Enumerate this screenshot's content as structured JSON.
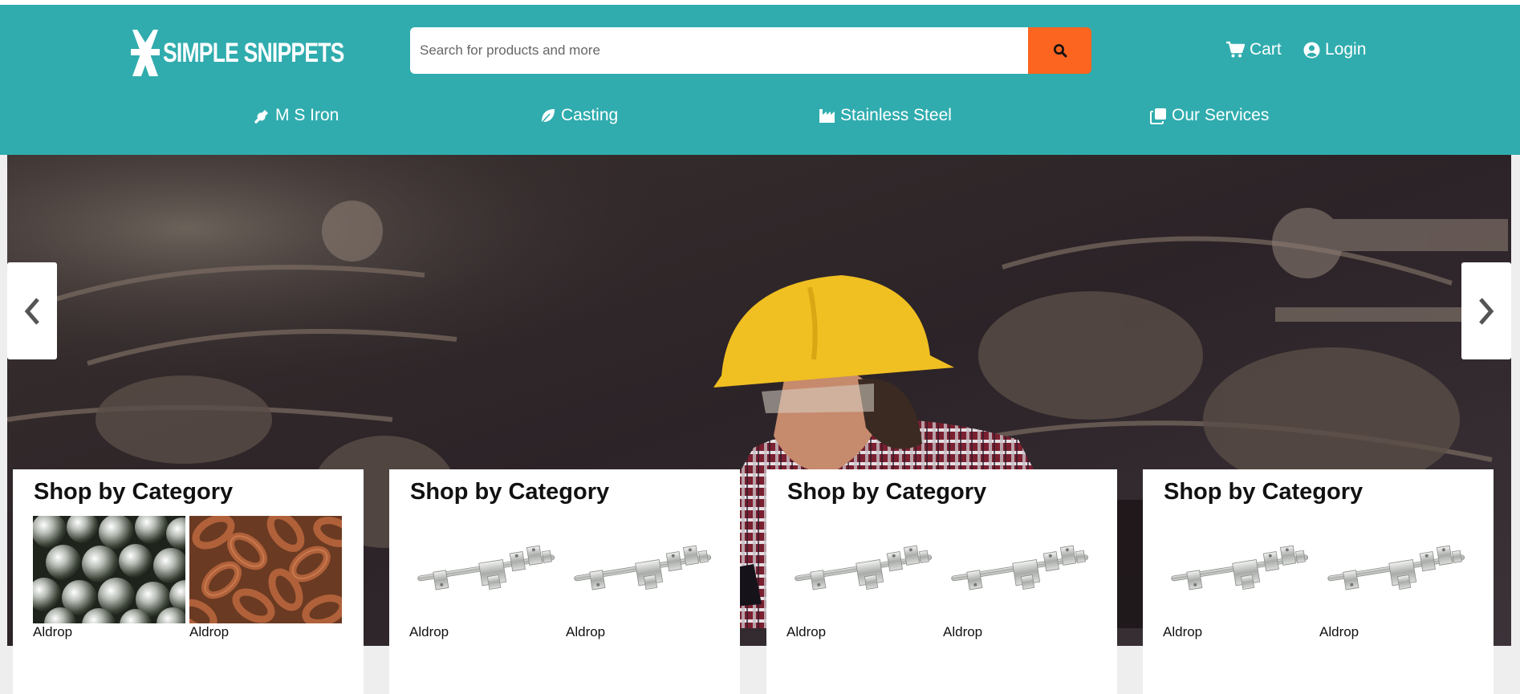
{
  "brand": {
    "name": "SIMPLE SNIPPETS"
  },
  "search": {
    "placeholder": "Search for products and more"
  },
  "header_links": {
    "cart": "Cart",
    "login": "Login"
  },
  "nav": [
    {
      "label": "M S Iron",
      "icon": "wrench-icon"
    },
    {
      "label": "Casting",
      "icon": "leaf-icon"
    },
    {
      "label": "Stainless Steel",
      "icon": "industry-icon"
    },
    {
      "label": "Our Services",
      "icon": "copy-icon"
    }
  ],
  "carousel": {
    "prev_icon": "chevron-left-icon",
    "next_icon": "chevron-right-icon"
  },
  "cards": [
    {
      "title": "Shop by Category",
      "items": [
        {
          "label": "Aldrop",
          "image": "steel-balls"
        },
        {
          "label": "Aldrop",
          "image": "rusty-chain"
        }
      ]
    },
    {
      "title": "Shop by Category",
      "items": [
        {
          "label": "Aldrop",
          "image": "aldrop-bolt"
        },
        {
          "label": "Aldrop",
          "image": "aldrop-bolt"
        }
      ]
    },
    {
      "title": "Shop by Category",
      "items": [
        {
          "label": "Aldrop",
          "image": "aldrop-bolt"
        },
        {
          "label": "Aldrop",
          "image": "aldrop-bolt"
        }
      ]
    },
    {
      "title": "Shop by Category",
      "items": [
        {
          "label": "Aldrop",
          "image": "aldrop-bolt"
        },
        {
          "label": "Aldrop",
          "image": "aldrop-bolt"
        }
      ]
    }
  ],
  "colors": {
    "header": "#30acae",
    "search_button": "#fc651f",
    "hero": "#2a2226"
  }
}
